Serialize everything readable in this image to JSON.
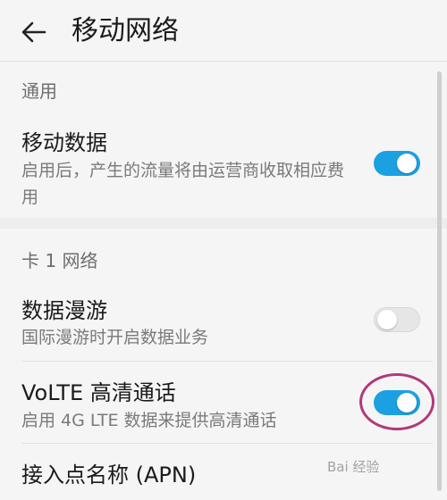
{
  "header": {
    "back_icon": "arrow-left-icon",
    "title": "移动网络"
  },
  "sections": {
    "general": {
      "label": "通用",
      "mobile_data": {
        "title": "移动数据",
        "subtitle": "启用后，产生的流量将由运营商收取相应费用",
        "enabled": true
      }
    },
    "sim1": {
      "label": "卡 1 网络",
      "data_roaming": {
        "title": "数据漫游",
        "subtitle": "国际漫游时开启数据业务",
        "enabled": false
      },
      "volte": {
        "title": "VoLTE 高清通话",
        "subtitle": "启用 4G LTE 数据来提供高清通话",
        "enabled": true
      },
      "apn": {
        "title": "接入点名称 (APN)"
      }
    }
  },
  "colors": {
    "toggle_on": "#1ba1e2",
    "toggle_off": "#e6e6e6",
    "annotation": "#b03a7a"
  },
  "watermark": "Bai 经验"
}
